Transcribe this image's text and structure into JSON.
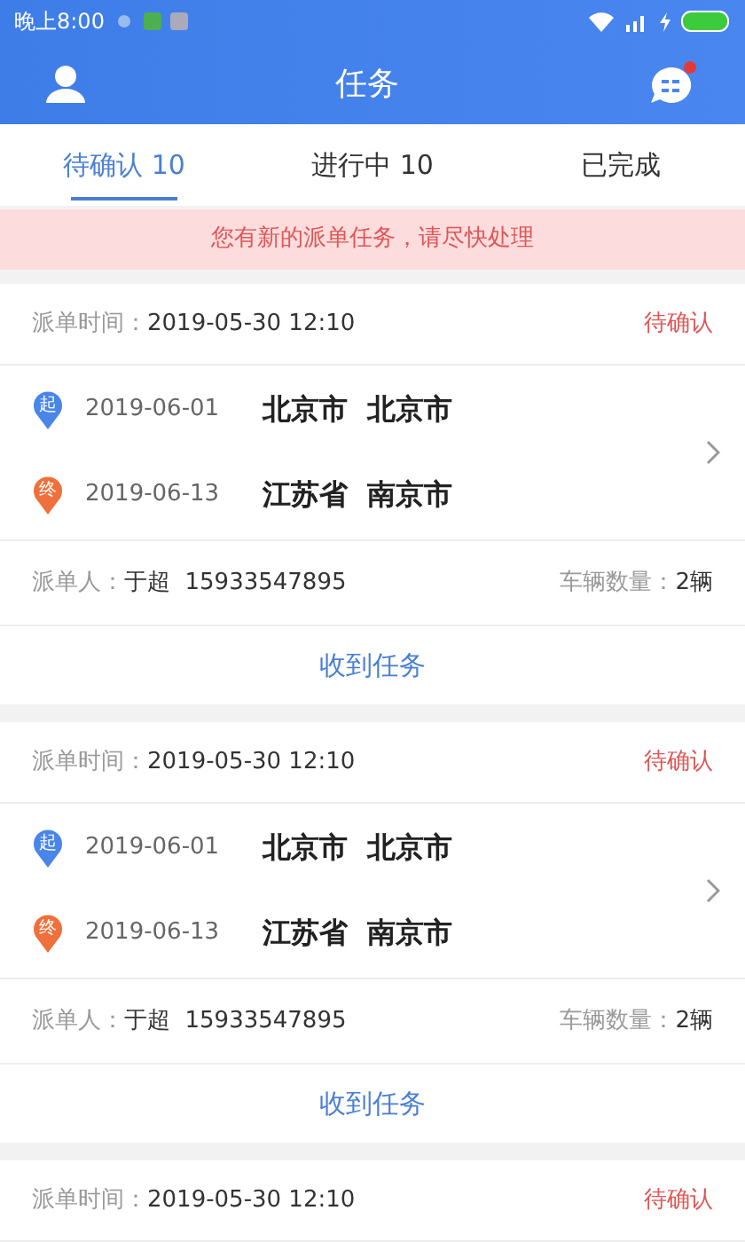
{
  "status_bar": {
    "time": "晚上8:00"
  },
  "header": {
    "title": "任务"
  },
  "tabs": [
    {
      "label": "待确认 10",
      "selected": true
    },
    {
      "label": "进行中 10",
      "selected": false
    },
    {
      "label": "已完成",
      "selected": false
    }
  ],
  "notice": "您有新的派单任务，请尽快处理",
  "tasks": [
    {
      "time_label": "派单时间：",
      "time": "2019-05-30 12:10",
      "status": "待确认",
      "stops": [
        {
          "kind": "start",
          "marker": "起",
          "date": "2019-06-01",
          "place": "北京市  北京市"
        },
        {
          "kind": "end",
          "marker": "终",
          "date": "2019-06-13",
          "place": "江苏省  南京市"
        }
      ],
      "sender_label": "派单人：",
      "sender": "于超  15933547895",
      "vehicles_label": "车辆数量：",
      "vehicles": "2辆",
      "action": "收到任务"
    },
    {
      "time_label": "派单时间：",
      "time": "2019-05-30 12:10",
      "status": "待确认",
      "stops": [
        {
          "kind": "start",
          "marker": "起",
          "date": "2019-06-01",
          "place": "北京市  北京市"
        },
        {
          "kind": "end",
          "marker": "终",
          "date": "2019-06-13",
          "place": "江苏省  南京市"
        }
      ],
      "sender_label": "派单人：",
      "sender": "于超  15933547895",
      "vehicles_label": "车辆数量：",
      "vehicles": "2辆",
      "action": "收到任务"
    },
    {
      "time_label": "派单时间：",
      "time": "2019-05-30 12:10",
      "status": "待确认"
    }
  ]
}
